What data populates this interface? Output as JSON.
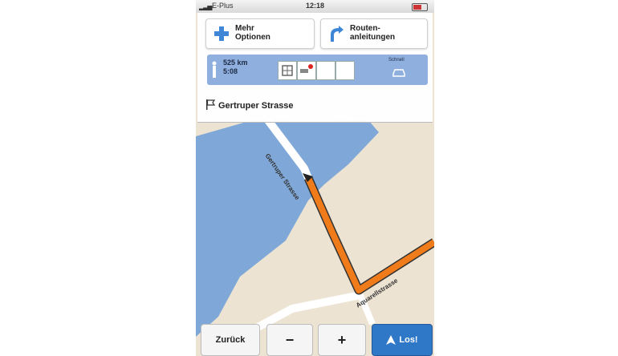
{
  "status_bar": {
    "carrier": "E-Plus",
    "time": "12:18"
  },
  "panel": {
    "options_button": {
      "label_line1": "Mehr",
      "label_line2": "Optionen",
      "icon": "plus-icon"
    },
    "route_button": {
      "label_line1": "Routen-",
      "label_line2": "anleitungen",
      "icon": "route-arrow-icon"
    },
    "info": {
      "distance": "525 km",
      "time": "5:08",
      "mode_label": "Schnell",
      "icon": "car-icon"
    },
    "destination": {
      "label": "Gertruper Strasse",
      "icon": "flag-icon"
    }
  },
  "map": {
    "street_labels": [
      "Gertruper Strasse",
      "Aquarellstrasse"
    ]
  },
  "bottom_bar": {
    "back_label": "Zurück",
    "zoom_out_label": "−",
    "zoom_in_label": "+",
    "go_label": "Los!"
  },
  "colors": {
    "water": "#7fa8d8",
    "land": "#ece3d2",
    "route": "#f07b1a",
    "accent": "#2f78c8"
  }
}
